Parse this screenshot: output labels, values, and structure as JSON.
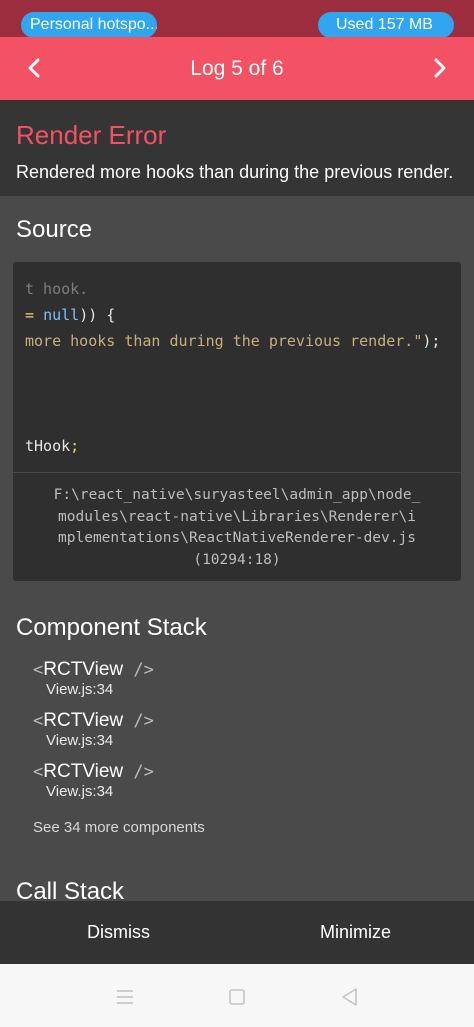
{
  "status_bar": {
    "hotspot_label": "Personal hotspo...",
    "data_usage_label": "Used  157 MB"
  },
  "header": {
    "title": "Log 5 of 6",
    "prev_icon": "chevron-left-icon",
    "next_icon": "chevron-right-icon"
  },
  "error": {
    "title": "Render Error",
    "message": "Rendered more hooks than during the previous render."
  },
  "source": {
    "heading": "Source",
    "code_lines": [
      {
        "segments": [
          {
            "text": "t hook.",
            "kind": "dim"
          }
        ]
      },
      {
        "segments": [
          {
            "text": "= ",
            "kind": "op"
          },
          {
            "text": "null",
            "kind": "kw"
          },
          {
            "text": ")) {",
            "kind": "plain"
          }
        ]
      },
      {
        "segments": [
          {
            "text": "more hooks than during the previous render.\"",
            "kind": "str"
          },
          {
            "text": ");",
            "kind": "plain"
          }
        ]
      },
      {
        "segments": []
      },
      {
        "segments": []
      },
      {
        "segments": [
          {
            "text": "tHook",
            "kind": "plain"
          },
          {
            "text": ";",
            "kind": "op"
          }
        ]
      }
    ],
    "file_path_lines": [
      "F:\\react_native\\suryasteel\\admin_app\\node_",
      "modules\\react-native\\Libraries\\Renderer\\i",
      "mplementations\\ReactNativeRenderer-dev.js",
      "(10294:18)"
    ]
  },
  "component_stack": {
    "heading": "Component Stack",
    "frames": [
      {
        "open": "<",
        "component": "RCTView",
        "close": " />",
        "file": "View.js:34"
      },
      {
        "open": "<",
        "component": "RCTView",
        "close": " />",
        "file": "View.js:34"
      },
      {
        "open": "<",
        "component": "RCTView",
        "close": " />",
        "file": "View.js:34"
      }
    ],
    "more_label": "See 34 more components"
  },
  "call_stack": {
    "heading": "Call Stack"
  },
  "footer": {
    "dismiss_label": "Dismiss",
    "minimize_label": "Minimize"
  },
  "system_nav": {
    "menu_icon": "menu-icon",
    "home_icon": "home-square-icon",
    "back_icon": "back-triangle-icon"
  },
  "colors": {
    "status_bar": "#9b2d3f",
    "header": "#f25263",
    "pill": "#2fa6ef",
    "error_title": "#f25263",
    "panel": "#4a4a4a",
    "code_bg": "#2f2f2f",
    "footer": "#333333",
    "system_nav": "#f7f7f7"
  }
}
